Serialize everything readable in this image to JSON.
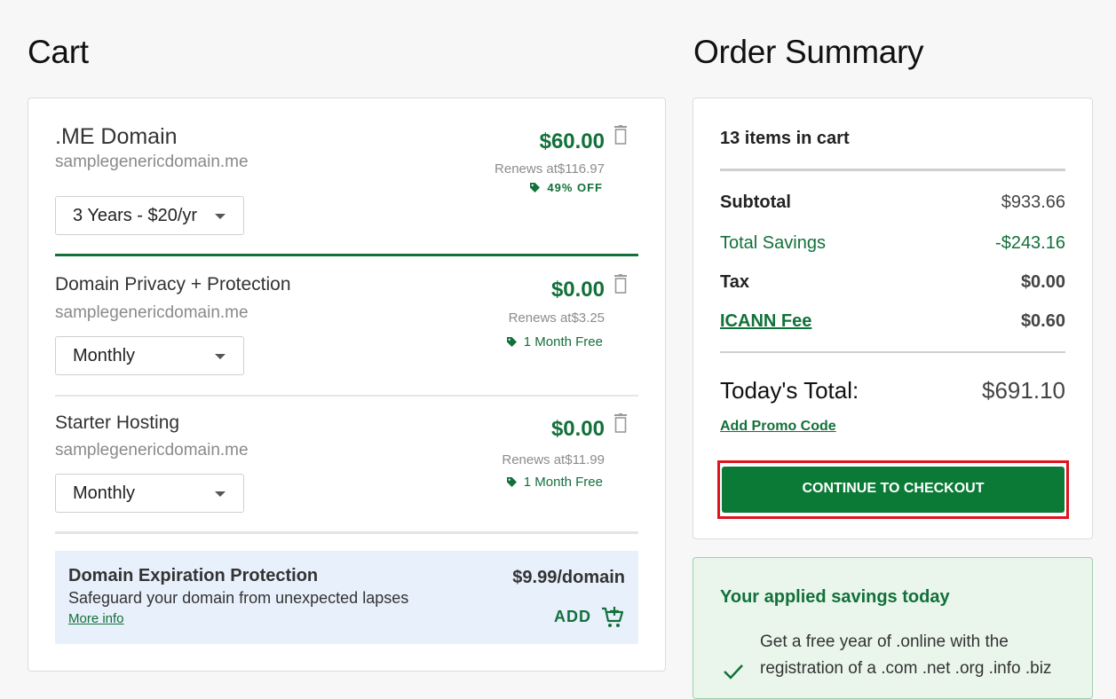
{
  "cart": {
    "title": "Cart",
    "items": [
      {
        "name": ".ME Domain",
        "domain": "samplegenericdomain.me",
        "price": "$60.00",
        "renews": "Renews at$116.97",
        "promo": "49% OFF",
        "term": "3 Years - $20/yr"
      },
      {
        "name": "Domain Privacy + Protection",
        "domain": "samplegenericdomain.me",
        "price": "$0.00",
        "renews": "Renews at$3.25",
        "promo": "1 Month Free",
        "term": "Monthly"
      },
      {
        "name": "Starter Hosting",
        "domain": "samplegenericdomain.me",
        "price": "$0.00",
        "renews": "Renews at$11.99",
        "promo": "1 Month Free",
        "term": "Monthly"
      }
    ],
    "upsell": {
      "title": "Domain Expiration Protection",
      "description": "Safeguard your domain from unexpected lapses",
      "more_info": "More info",
      "price": "$9.99/domain",
      "add_label": "ADD"
    }
  },
  "summary": {
    "title": "Order Summary",
    "items_count": "13 items in cart",
    "subtotal_label": "Subtotal",
    "subtotal_value": "$933.66",
    "savings_label": "Total Savings",
    "savings_value": "-$243.16",
    "tax_label": "Tax",
    "tax_value": "$0.00",
    "icann_label": "ICANN Fee",
    "icann_value": "$0.60",
    "total_label": "Today's Total:",
    "total_value": "$691.10",
    "promo_link": "Add Promo Code",
    "checkout_label": "CONTINUE TO CHECKOUT"
  },
  "savings_panel": {
    "title": "Your applied savings today",
    "line1": "Get a free year of .online with the",
    "line2": "registration of a .com .net .org .info .biz"
  },
  "colors": {
    "brand_green": "#12703a",
    "highlight_red": "#e0141e",
    "upsell_bg": "#e8f0fb",
    "savings_bg": "#eaf6ec"
  },
  "icons": [
    "trash-icon",
    "tag-icon",
    "chevron-down-icon",
    "cart-add-icon",
    "check-icon"
  ]
}
